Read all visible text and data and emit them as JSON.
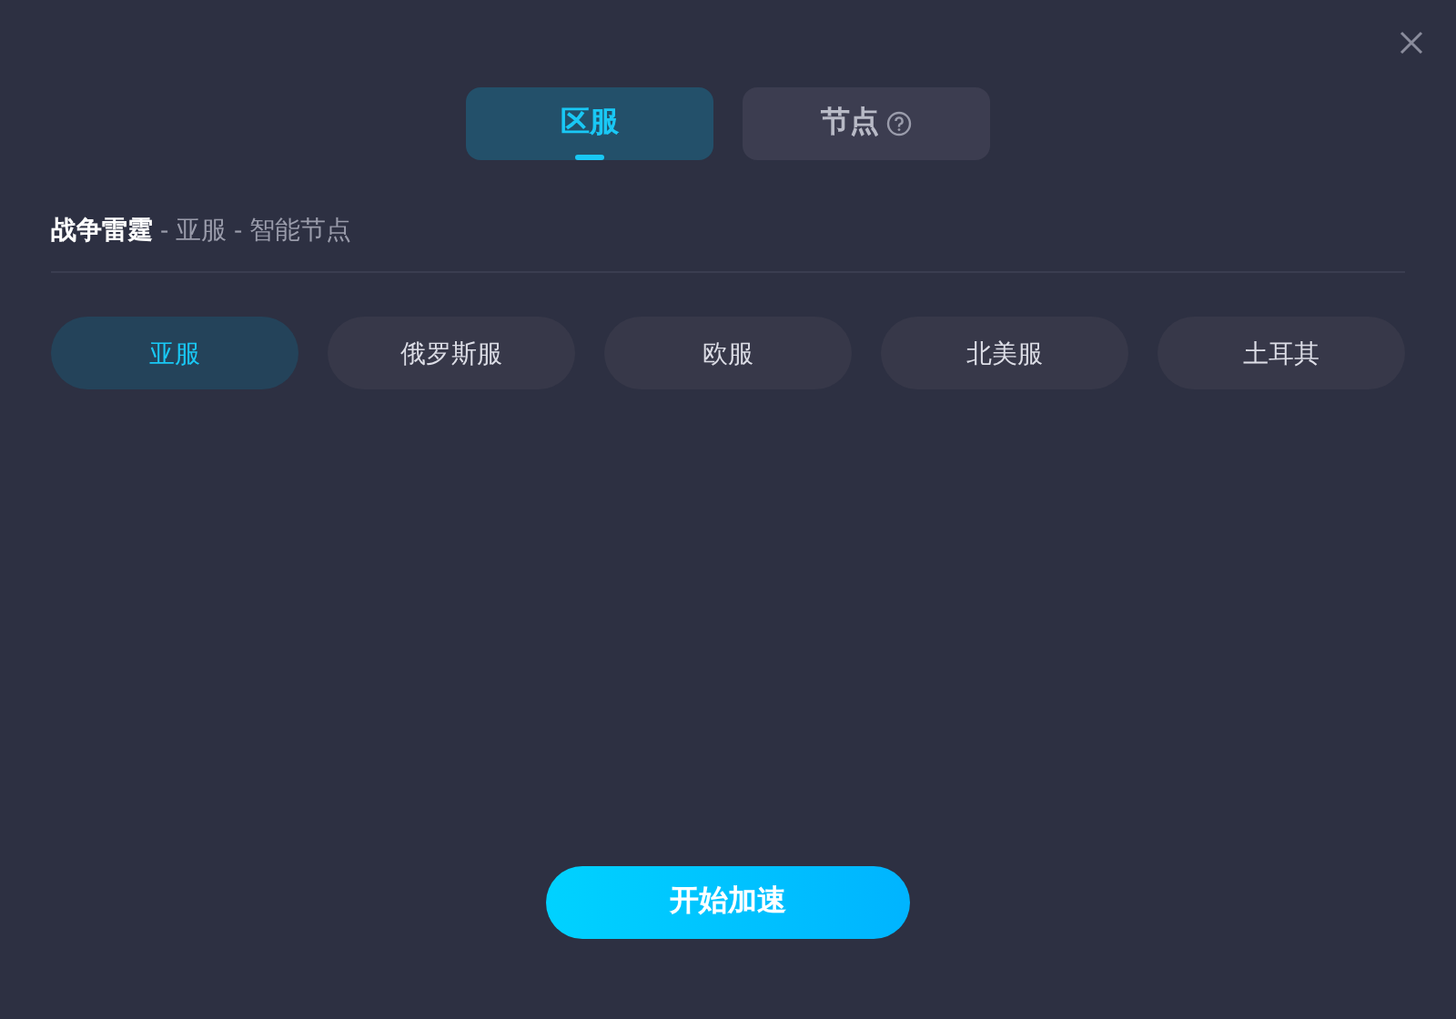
{
  "tabs": [
    {
      "label": "区服",
      "selected": true,
      "help": false
    },
    {
      "label": "节点",
      "selected": false,
      "help": true
    }
  ],
  "breadcrumb": {
    "game": "战争雷霆",
    "path": "- 亚服 - 智能节点"
  },
  "regions": [
    {
      "label": "亚服",
      "selected": true
    },
    {
      "label": "俄罗斯服",
      "selected": false
    },
    {
      "label": "欧服",
      "selected": false
    },
    {
      "label": "北美服",
      "selected": false
    },
    {
      "label": "土耳其",
      "selected": false
    }
  ],
  "start_button": "开始加速"
}
